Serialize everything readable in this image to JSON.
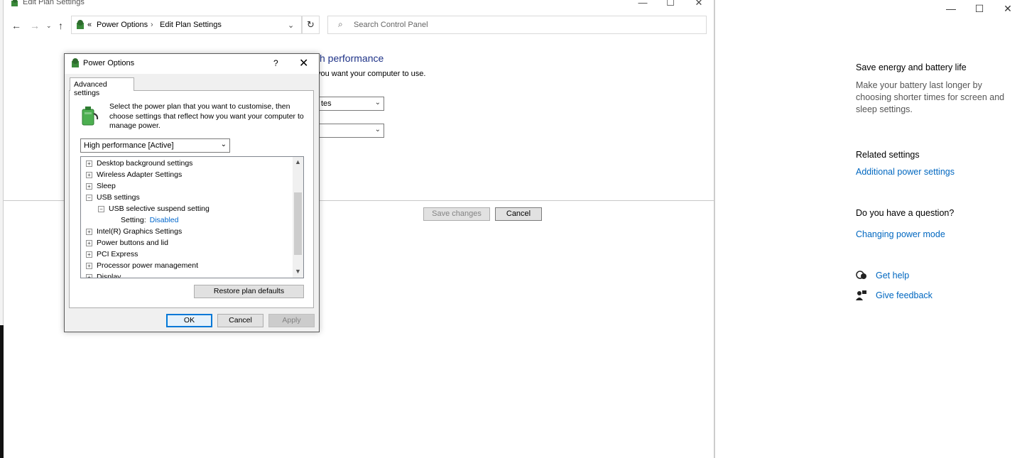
{
  "explorer": {
    "title": "Edit Plan Settings",
    "breadcrumb": [
      "Power Options",
      "Edit Plan Settings"
    ],
    "breadcrumb_prefix": "«",
    "search_placeholder": "Search Control Panel",
    "plan_title": "h performance",
    "plan_subtitle": "you want your computer to use.",
    "select1_value": "tes",
    "select2_value": "",
    "save_changes": "Save changes",
    "cancel": "Cancel"
  },
  "dialog": {
    "title": "Power Options",
    "help": "?",
    "tab": "Advanced settings",
    "description": "Select the power plan that you want to customise, then choose settings that reflect how you want your computer to manage power.",
    "plan_selected": "High performance [Active]",
    "tree": [
      {
        "label": "Desktop background settings",
        "state": "+"
      },
      {
        "label": "Wireless Adapter Settings",
        "state": "+"
      },
      {
        "label": "Sleep",
        "state": "+"
      },
      {
        "label": "USB settings",
        "state": "−"
      },
      {
        "label": "USB selective suspend setting",
        "state": "−"
      },
      {
        "label": "Setting:",
        "value": "Disabled"
      },
      {
        "label": "Intel(R) Graphics Settings",
        "state": "+"
      },
      {
        "label": "Power buttons and lid",
        "state": "+"
      },
      {
        "label": "PCI Express",
        "state": "+"
      },
      {
        "label": "Processor power management",
        "state": "+"
      },
      {
        "label": "Display",
        "state": "+"
      }
    ],
    "restore": "Restore plan defaults",
    "ok": "OK",
    "cancel": "Cancel",
    "apply": "Apply"
  },
  "settings": {
    "save_energy_title": "Save energy and battery life",
    "save_energy_text": "Make your battery last longer by choosing shorter times for screen and sleep settings.",
    "related_title": "Related settings",
    "additional_power": "Additional power settings",
    "question_title": "Do you have a question?",
    "changing_power_mode": "Changing power mode",
    "get_help": "Get help",
    "give_feedback": "Give feedback"
  },
  "colors": {
    "link": "#0067c0",
    "plan_title": "#1e3287",
    "setting_value": "#0066cc"
  }
}
